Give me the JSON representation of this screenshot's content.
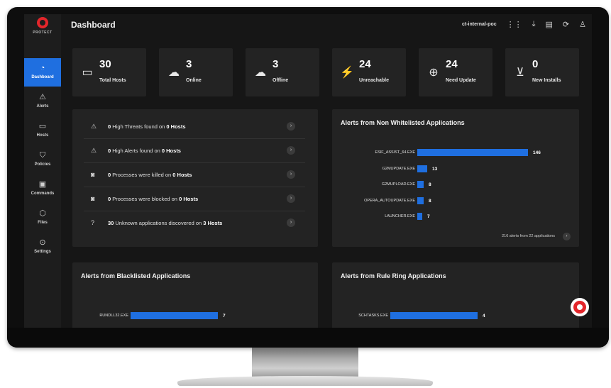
{
  "app": {
    "brand": "PROTECT",
    "page_title": "Dashboard",
    "tenant": "ct-internal-poc"
  },
  "header_icons": [
    "apps-grid-icon",
    "download-icon",
    "document-icon",
    "refresh-icon",
    "user-icon"
  ],
  "sidebar": {
    "items": [
      {
        "label": "Dashboard",
        "icon": "speedometer-icon",
        "glyph": "◔",
        "active": true
      },
      {
        "label": "Alerts",
        "icon": "warning-icon",
        "glyph": "⚠",
        "active": false
      },
      {
        "label": "Hosts",
        "icon": "monitor-icon",
        "glyph": "▭",
        "active": false
      },
      {
        "label": "Policies",
        "icon": "shield-icon",
        "glyph": "⛉",
        "active": false
      },
      {
        "label": "Commands",
        "icon": "terminal-icon",
        "glyph": "▣",
        "active": false
      },
      {
        "label": "Files",
        "icon": "cube-icon",
        "glyph": "⬡",
        "active": false
      },
      {
        "label": "Settings",
        "icon": "settings-icon",
        "glyph": "⊙",
        "active": false
      }
    ]
  },
  "stats": [
    {
      "value": "30",
      "label": "Total Hosts",
      "icon": "monitor-icon",
      "glyph": "▭"
    },
    {
      "value": "3",
      "label": "Online",
      "icon": "cloud-icon",
      "glyph": "☁"
    },
    {
      "value": "3",
      "label": "Offline",
      "icon": "cloud-off-icon",
      "glyph": "☁"
    },
    {
      "value": "24",
      "label": "Unreachable",
      "icon": "signal-off-icon",
      "glyph": "⚡"
    },
    {
      "value": "24",
      "label": "Need Update",
      "icon": "update-arrow-icon",
      "glyph": "⊕"
    },
    {
      "value": "0",
      "label": "New Installs",
      "icon": "install-icon",
      "glyph": "⊻"
    }
  ],
  "summary": {
    "rows": [
      {
        "icon": "warning-icon",
        "glyph": "⚠",
        "count": "0",
        "text": " High Threats found on ",
        "hosts": "0 Hosts"
      },
      {
        "icon": "warning-icon",
        "glyph": "⚠",
        "count": "0",
        "text": " High Alerts found on ",
        "hosts": "0 Hosts"
      },
      {
        "icon": "stop-icon",
        "glyph": "◙",
        "count": "0",
        "text": " Processes were killed on ",
        "hosts": "0 Hosts"
      },
      {
        "icon": "stop-icon",
        "glyph": "◙",
        "count": "0",
        "text": " Processes were blocked on ",
        "hosts": "0 Hosts"
      },
      {
        "icon": "help-icon",
        "glyph": "?",
        "count": "30",
        "text": " Unknown applications discovered on ",
        "hosts": "3 Hosts"
      }
    ]
  },
  "panels": {
    "non_whitelisted": {
      "title": "Alerts from Non Whitelisted Applications",
      "footer": "216 alerts from 22 applications"
    },
    "blacklisted": {
      "title": "Alerts from Blacklisted Applications"
    },
    "rule_ring": {
      "title": "Alerts from Rule Ring Applications"
    }
  },
  "chart_data": [
    {
      "type": "bar",
      "title": "Alerts from Non Whitelisted Applications",
      "categories": [
        "ESIF_ASSIST_64.EXE",
        "G2MUPDATE.EXE",
        "G2MUPLOAD.EXE",
        "OPERA_AUTOUPDATE.EXE",
        "LAUNCHER.EXE"
      ],
      "values": [
        146,
        13,
        8,
        8,
        7
      ],
      "orientation": "horizontal",
      "xlim": [
        0,
        146
      ]
    },
    {
      "type": "bar",
      "title": "Alerts from Blacklisted Applications",
      "categories": [
        "RUNDLL32.EXE"
      ],
      "values": [
        7
      ],
      "orientation": "horizontal",
      "xlim": [
        0,
        7
      ]
    },
    {
      "type": "bar",
      "title": "Alerts from Rule Ring Applications",
      "categories": [
        "SCHTASKS.EXE"
      ],
      "values": [
        4
      ],
      "orientation": "horizontal",
      "xlim": [
        0,
        4
      ]
    }
  ],
  "colors": {
    "accent": "#1f6fe0",
    "brand": "#e3262b",
    "panel": "#232323",
    "background": "#161616"
  }
}
